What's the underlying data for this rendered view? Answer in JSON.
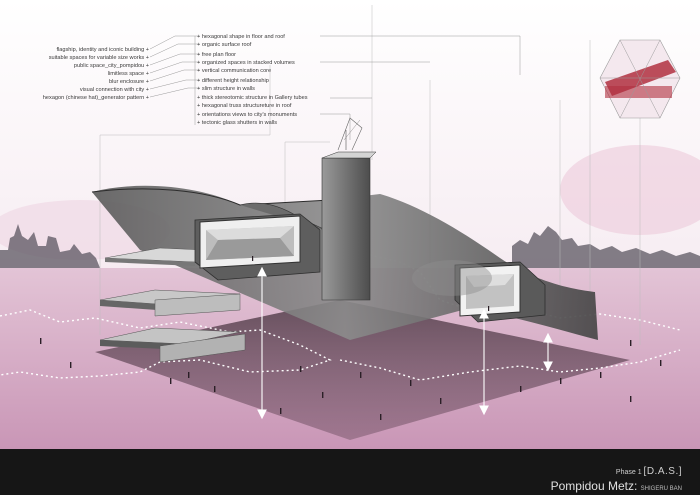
{
  "left_labels": [
    "flagship, identity and iconic building +",
    "suitable spaces for variable size works +",
    "public space_city_pompidou +",
    "limitless space +",
    "blur enclosure +",
    "visual connection with city +",
    "hexagon (chinese hat)_generator pattern +"
  ],
  "right_labels": [
    "+ hexagonal shape in floor and roof",
    "+ organic surface roof",
    "+ free plan floor",
    "+ organized spaces in stacked volumes",
    "+ vertical communication core",
    "+ different height relationship",
    "+ slim structure in walls",
    "+ thick stereotomic structure in Gallery tubes",
    "+ hexagonal truss structureture in roof",
    "+ orientations views to city's monuments",
    "+ tectonic glass shutters in walls"
  ],
  "footer": {
    "phase_prefix": "Phase 1",
    "phase_code": "[D.A.S.]",
    "project": "Pompidou Metz:",
    "architect": "SHIGERU BAN"
  },
  "colors": {
    "ground_pink": "#d9b3c9",
    "accent_red": "#b03040",
    "footer_bg": "#161616"
  }
}
